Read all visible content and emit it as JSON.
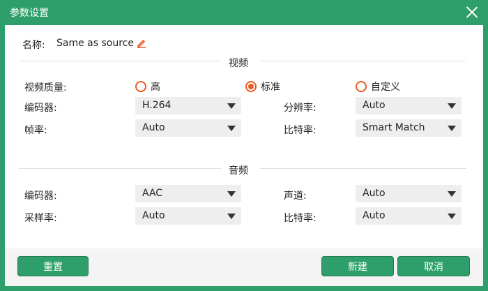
{
  "window": {
    "title": "参数设置"
  },
  "name_row": {
    "label": "名称:",
    "value": "Same as source"
  },
  "video": {
    "section_title": "视频",
    "quality": {
      "label": "视频质量:",
      "options": [
        {
          "label": "高",
          "checked": false
        },
        {
          "label": "标准",
          "checked": true
        },
        {
          "label": "自定义",
          "checked": false
        }
      ]
    },
    "encoder": {
      "label": "编码器:",
      "value": "H.264"
    },
    "resolution": {
      "label": "分辨率:",
      "value": "Auto"
    },
    "framerate": {
      "label": "帧率:",
      "value": "Auto"
    },
    "bitrate": {
      "label": "比特率:",
      "value": "Smart Match"
    }
  },
  "audio": {
    "section_title": "音频",
    "encoder": {
      "label": "编码器:",
      "value": "AAC"
    },
    "channel": {
      "label": "声道:",
      "value": "Auto"
    },
    "samplerate": {
      "label": "采样率:",
      "value": "Auto"
    },
    "bitrate": {
      "label": "比特率:",
      "value": "Auto"
    }
  },
  "footer": {
    "reset_label": "重置",
    "new_label": "新建",
    "cancel_label": "取消"
  },
  "colors": {
    "accent": "#2e9f6a",
    "radio": "#f05a22",
    "select_bg": "#eeeeee"
  }
}
